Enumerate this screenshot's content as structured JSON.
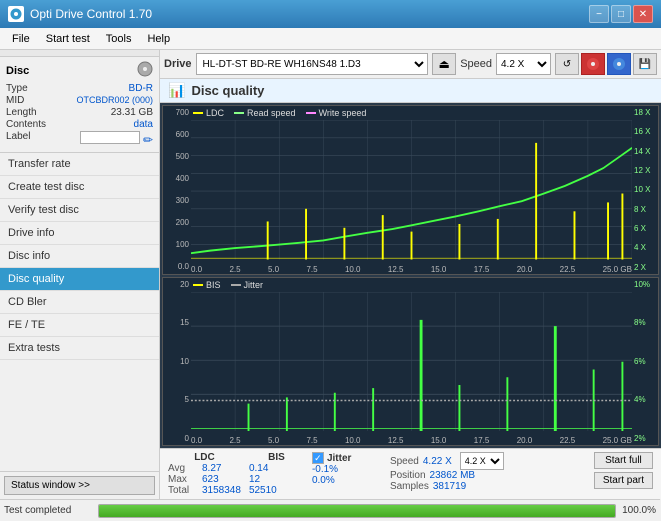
{
  "titleBar": {
    "title": "Opti Drive Control 1.70",
    "minBtn": "−",
    "maxBtn": "□",
    "closeBtn": "✕"
  },
  "menuBar": {
    "items": [
      "File",
      "Start test",
      "Tools",
      "Help"
    ]
  },
  "topBar": {
    "driveLabel": "Drive",
    "driveValue": "(G:) HL-DT-ST BD-RE  WH16NS48 1.D3",
    "speedLabel": "Speed",
    "speedValue": "4.2 X"
  },
  "discPanel": {
    "title": "Disc",
    "typeLabel": "Type",
    "typeValue": "BD-R",
    "midLabel": "MID",
    "midValue": "OTCBDR002 (000)",
    "lengthLabel": "Length",
    "lengthValue": "23.31 GB",
    "contentsLabel": "Contents",
    "contentsValue": "data",
    "labelLabel": "Label"
  },
  "navItems": [
    {
      "id": "transfer-rate",
      "label": "Transfer rate"
    },
    {
      "id": "create-test-disc",
      "label": "Create test disc"
    },
    {
      "id": "verify-test-disc",
      "label": "Verify test disc"
    },
    {
      "id": "drive-info",
      "label": "Drive info"
    },
    {
      "id": "disc-info",
      "label": "Disc info"
    },
    {
      "id": "disc-quality",
      "label": "Disc quality",
      "active": true
    },
    {
      "id": "cd-bler",
      "label": "CD Bler"
    },
    {
      "id": "fe-te",
      "label": "FE / TE"
    },
    {
      "id": "extra-tests",
      "label": "Extra tests"
    }
  ],
  "statusWindow": {
    "label": "Status window >>"
  },
  "chartHeader": {
    "title": "Disc quality"
  },
  "chart1": {
    "legendItems": [
      {
        "id": "ldc",
        "label": "LDC"
      },
      {
        "id": "read-speed",
        "label": "Read speed"
      },
      {
        "id": "write-speed",
        "label": "Write speed"
      }
    ],
    "yLabels": [
      "700",
      "600",
      "500",
      "400",
      "300",
      "200",
      "100",
      "0.0"
    ],
    "xLabels": [
      "0.0",
      "2.5",
      "5.0",
      "7.5",
      "10.0",
      "12.5",
      "15.0",
      "17.5",
      "20.0",
      "22.5",
      "25.0 GB"
    ],
    "yRightLabels": [
      "18 X",
      "16 X",
      "14 X",
      "12 X",
      "10 X",
      "8 X",
      "6 X",
      "4 X",
      "2 X"
    ]
  },
  "chart2": {
    "legendItems": [
      {
        "id": "bis",
        "label": "BIS"
      },
      {
        "id": "jitter",
        "label": "Jitter"
      }
    ],
    "yLabels": [
      "20",
      "15",
      "10",
      "5",
      "0"
    ],
    "xLabels": [
      "0.0",
      "2.5",
      "5.0",
      "7.5",
      "10.0",
      "12.5",
      "15.0",
      "17.5",
      "20.0",
      "22.5",
      "25.0 GB"
    ],
    "yRightLabels": [
      "10%",
      "8%",
      "6%",
      "4%",
      "2%"
    ]
  },
  "statsRow": {
    "ldcLabel": "LDC",
    "bisLabel": "BIS",
    "jitterLabel": "Jitter",
    "avgLabel": "Avg",
    "maxLabel": "Max",
    "totalLabel": "Total",
    "ldcAvg": "8.27",
    "ldcMax": "623",
    "ldcTotal": "3158348",
    "bisAvg": "0.14",
    "bisMax": "12",
    "bisTotal": "52510",
    "jitterAvg": "-0.1%",
    "jitterMax": "0.0%",
    "speedLabel": "Speed",
    "speedValue": "4.22 X",
    "positionLabel": "Position",
    "positionValue": "23862 MB",
    "samplesLabel": "Samples",
    "samplesValue": "381719",
    "speedDropdown": "4.2 X",
    "startFullBtn": "Start full",
    "startPartBtn": "Start part"
  },
  "statusBar": {
    "text": "Test completed",
    "progressPct": "100.0%"
  }
}
